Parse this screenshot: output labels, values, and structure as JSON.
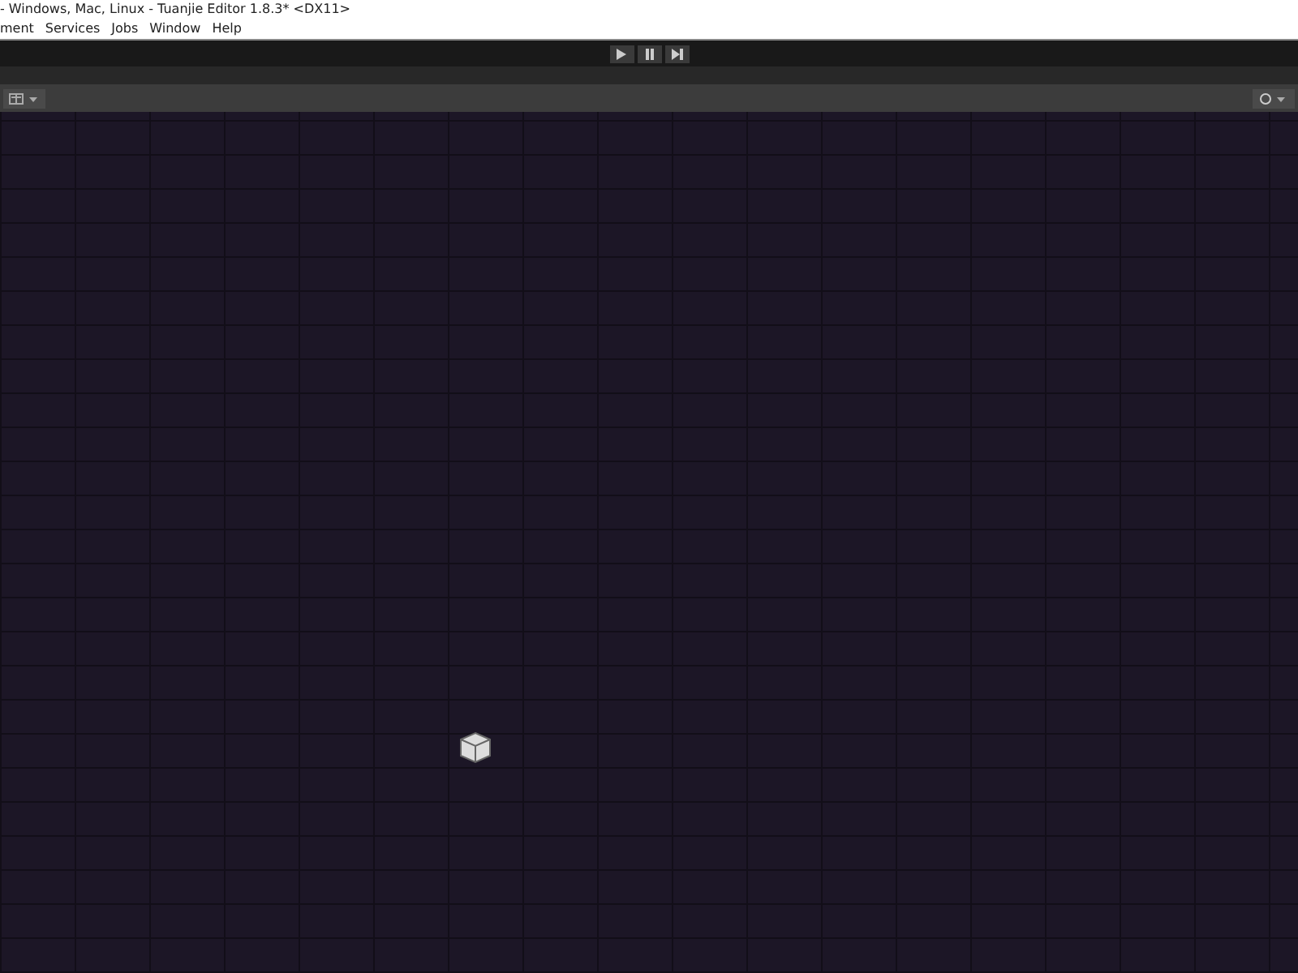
{
  "window": {
    "title": "- Windows, Mac, Linux - Tuanjie Editor 1.8.3* <DX11>"
  },
  "menu": [
    "ment",
    "Services",
    "Jobs",
    "Window",
    "Help"
  ]
}
